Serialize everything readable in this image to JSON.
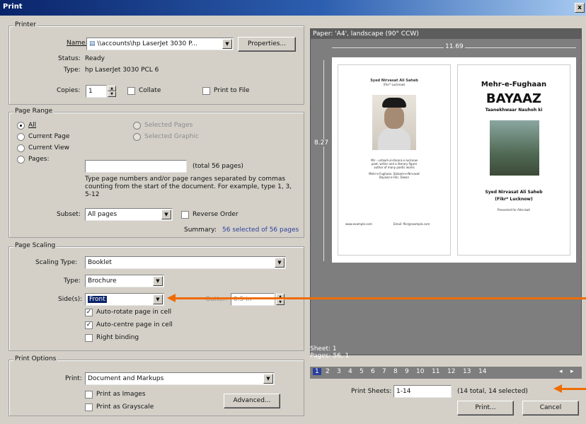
{
  "window": {
    "title": "Print",
    "close": "x"
  },
  "printer": {
    "group": "Printer",
    "name_label": "Name:",
    "name_value": "\\\\accounts\\hp LaserJet 3030 P...",
    "properties": "Properties...",
    "status_label": "Status:",
    "status_value": "Ready",
    "type_label": "Type:",
    "type_value": "hp LaserJet 3030 PCL 6",
    "copies_label": "Copies:",
    "copies_value": "1",
    "collate": "Collate",
    "print_to_file": "Print to File"
  },
  "page_range": {
    "group": "Page Range",
    "all": "All",
    "current_page": "Current Page",
    "current_view": "Current View",
    "pages": "Pages:",
    "selected_pages": "Selected Pages",
    "selected_graphic": "Selected Graphic",
    "pages_total": "(total 56 pages)",
    "help_text": "Type page numbers and/or page ranges separated by commas counting from the start of the document. For example, type 1, 3, 5-12",
    "subset_label": "Subset:",
    "subset_value": "All pages",
    "reverse_order": "Reverse Order",
    "summary_label": "Summary:",
    "summary_value": "56 selected of 56 pages"
  },
  "page_scaling": {
    "group": "Page Scaling",
    "scaling_type_label": "Scaling Type:",
    "scaling_type_value": "Booklet",
    "type_label": "Type:",
    "type_value": "Brochure",
    "sides_label": "Side(s):",
    "sides_value": "Front",
    "gutter_label": "Gutter:",
    "gutter_value": "0.5 in",
    "auto_rotate": "Auto-rotate page in cell",
    "auto_centre": "Auto-centre page in cell",
    "right_binding": "Right binding"
  },
  "print_options": {
    "group": "Print Options",
    "print_label": "Print:",
    "print_value": "Document and Markups",
    "print_as_images": "Print as Images",
    "print_as_grayscale": "Print as Grayscale",
    "advanced": "Advanced..."
  },
  "preview": {
    "header": "Paper: 'A4', landscape (90° CCW)",
    "width_label": "11.69",
    "height_label": "8.27",
    "left_page": {
      "title": "Syed Nirvasat Ali Saheb",
      "subtitle": "(Fikr* Lucknow)",
      "lines": [
        "Mir - ustaad-ul-shoara-o-lucknow",
        "poet, writer and a literary figure",
        "author of many poetic works",
        "Mehr-e-Fughaan, Kalaam-e-Nirvasat",
        "Bayaaz-e-Fikr, Diwan"
      ],
      "footer_left": "www.example.com",
      "footer_right": "Email: fikr@example.com"
    },
    "right_page": {
      "title": "Mehr-e-Fughaan",
      "big_title": "BAYAAZ",
      "subtitle": "Taanekhwaar Nauhoh ki",
      "author": "Syed Nirvasat Ali Saheb",
      "author_sub": "(Fikr* Lucknow)",
      "note": "Presented for Ahle-bait"
    },
    "sheet_label": "Sheet: 1",
    "pages_label": "Pages: 56, 1",
    "page_numbers": [
      "1",
      "2",
      "3",
      "4",
      "5",
      "6",
      "7",
      "8",
      "9",
      "10",
      "11",
      "12",
      "13",
      "14"
    ],
    "print_sheets_label": "Print Sheets:",
    "print_sheets_value": "1-14",
    "print_sheets_summary": "(14 total, 14 selected)"
  },
  "buttons": {
    "print": "Print...",
    "cancel": "Cancel"
  },
  "colors": {
    "title_bar": "#0a246a",
    "annotation_arrow": "#ef6c00",
    "preview_bg": "#7e7e7e"
  }
}
